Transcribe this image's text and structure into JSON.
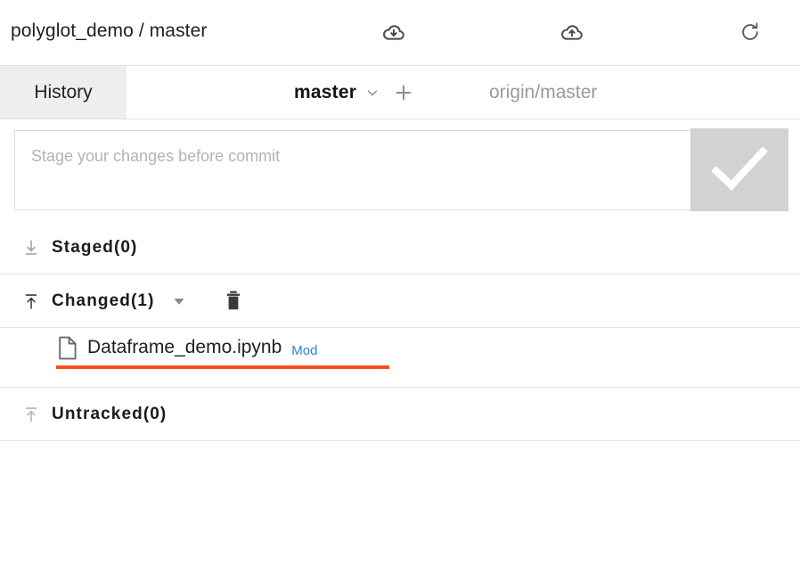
{
  "header": {
    "repo_title": "polyglot_demo / master",
    "actions": [
      {
        "name": "cloud-download-icon",
        "label": "Pull"
      },
      {
        "name": "cloud-upload-icon",
        "label": "Push"
      },
      {
        "name": "refresh-icon",
        "label": "Refresh"
      }
    ]
  },
  "tabbar": {
    "history_tab": "History",
    "branch_name": "master",
    "branch_caret_icon": "chevron-down-icon",
    "add_branch_icon": "plus-icon",
    "remote_branch": "origin/master"
  },
  "commit": {
    "placeholder": "Stage your changes before commit",
    "value": "",
    "submit_icon": "check-icon",
    "submit_color": "#d2d2d2"
  },
  "sections": [
    {
      "id": "staged",
      "label": "Staged(0)",
      "icon": "arrow-down-to-line-icon",
      "count": 0,
      "has_caret": false,
      "has_trash": false
    },
    {
      "id": "changed",
      "label": "Changed(1)",
      "icon": "arrow-up-to-line-icon",
      "count": 1,
      "has_caret": true,
      "caret_icon": "caret-down-icon",
      "has_trash": true,
      "trash_icon": "trash-icon"
    },
    {
      "id": "untracked",
      "label": "Untracked(0)",
      "icon": "arrow-up-to-line-icon",
      "count": 0,
      "has_caret": false,
      "has_trash": false
    }
  ],
  "changed_files": [
    {
      "icon": "file-icon",
      "name": "Dataframe_demo.ipynb",
      "status": "Mod",
      "status_color": "#2f7fe0",
      "highlight_color": "#f4511e"
    }
  ]
}
